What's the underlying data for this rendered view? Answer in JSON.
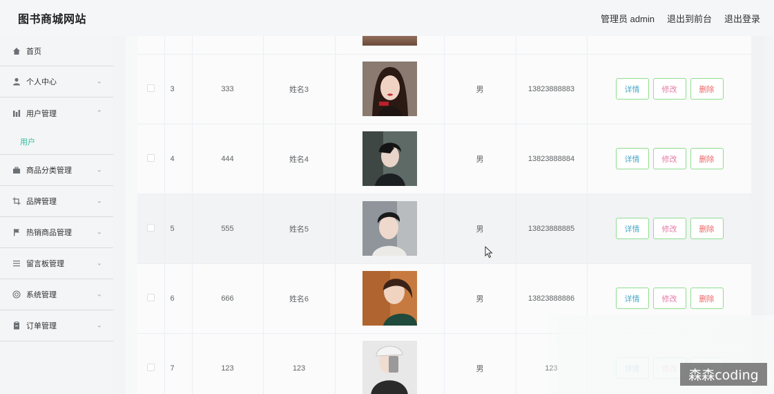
{
  "header": {
    "brand": "图书商城网站",
    "admin_label": "管理员 admin",
    "to_front": "退出到前台",
    "logout": "退出登录"
  },
  "sidebar": {
    "items": [
      {
        "label": "首页",
        "icon": "home-icon"
      },
      {
        "label": "个人中心",
        "icon": "user-icon"
      },
      {
        "label": "用户管理",
        "icon": "bar-chart-icon"
      },
      {
        "label": "用户",
        "icon": ""
      },
      {
        "label": "商品分类管理",
        "icon": "briefcase-icon"
      },
      {
        "label": "品牌管理",
        "icon": "crop-icon"
      },
      {
        "label": "热销商品管理",
        "icon": "flag-icon"
      },
      {
        "label": "留言板管理",
        "icon": "menu-icon"
      },
      {
        "label": "系统管理",
        "icon": "settings-icon"
      },
      {
        "label": "订单管理",
        "icon": "clipboard-icon"
      }
    ]
  },
  "table": {
    "rows": [
      {
        "idx": "3",
        "account": "333",
        "name": "姓名3",
        "sex": "男",
        "phone": "13823888883"
      },
      {
        "idx": "4",
        "account": "444",
        "name": "姓名4",
        "sex": "男",
        "phone": "13823888884"
      },
      {
        "idx": "5",
        "account": "555",
        "name": "姓名5",
        "sex": "男",
        "phone": "13823888885"
      },
      {
        "idx": "6",
        "account": "666",
        "name": "姓名6",
        "sex": "男",
        "phone": "13823888886"
      },
      {
        "idx": "7",
        "account": "123",
        "name": "123",
        "sex": "男",
        "phone": "123"
      }
    ],
    "actions": {
      "detail": "详情",
      "edit": "修改",
      "delete": "删除"
    }
  },
  "watermark": "森森coding",
  "colors": {
    "accent": "#2bbd9b",
    "button_border": "#8fdc8f",
    "detail": "#4aa8c7",
    "edit": "#e27aa4",
    "delete": "#ee6666"
  }
}
